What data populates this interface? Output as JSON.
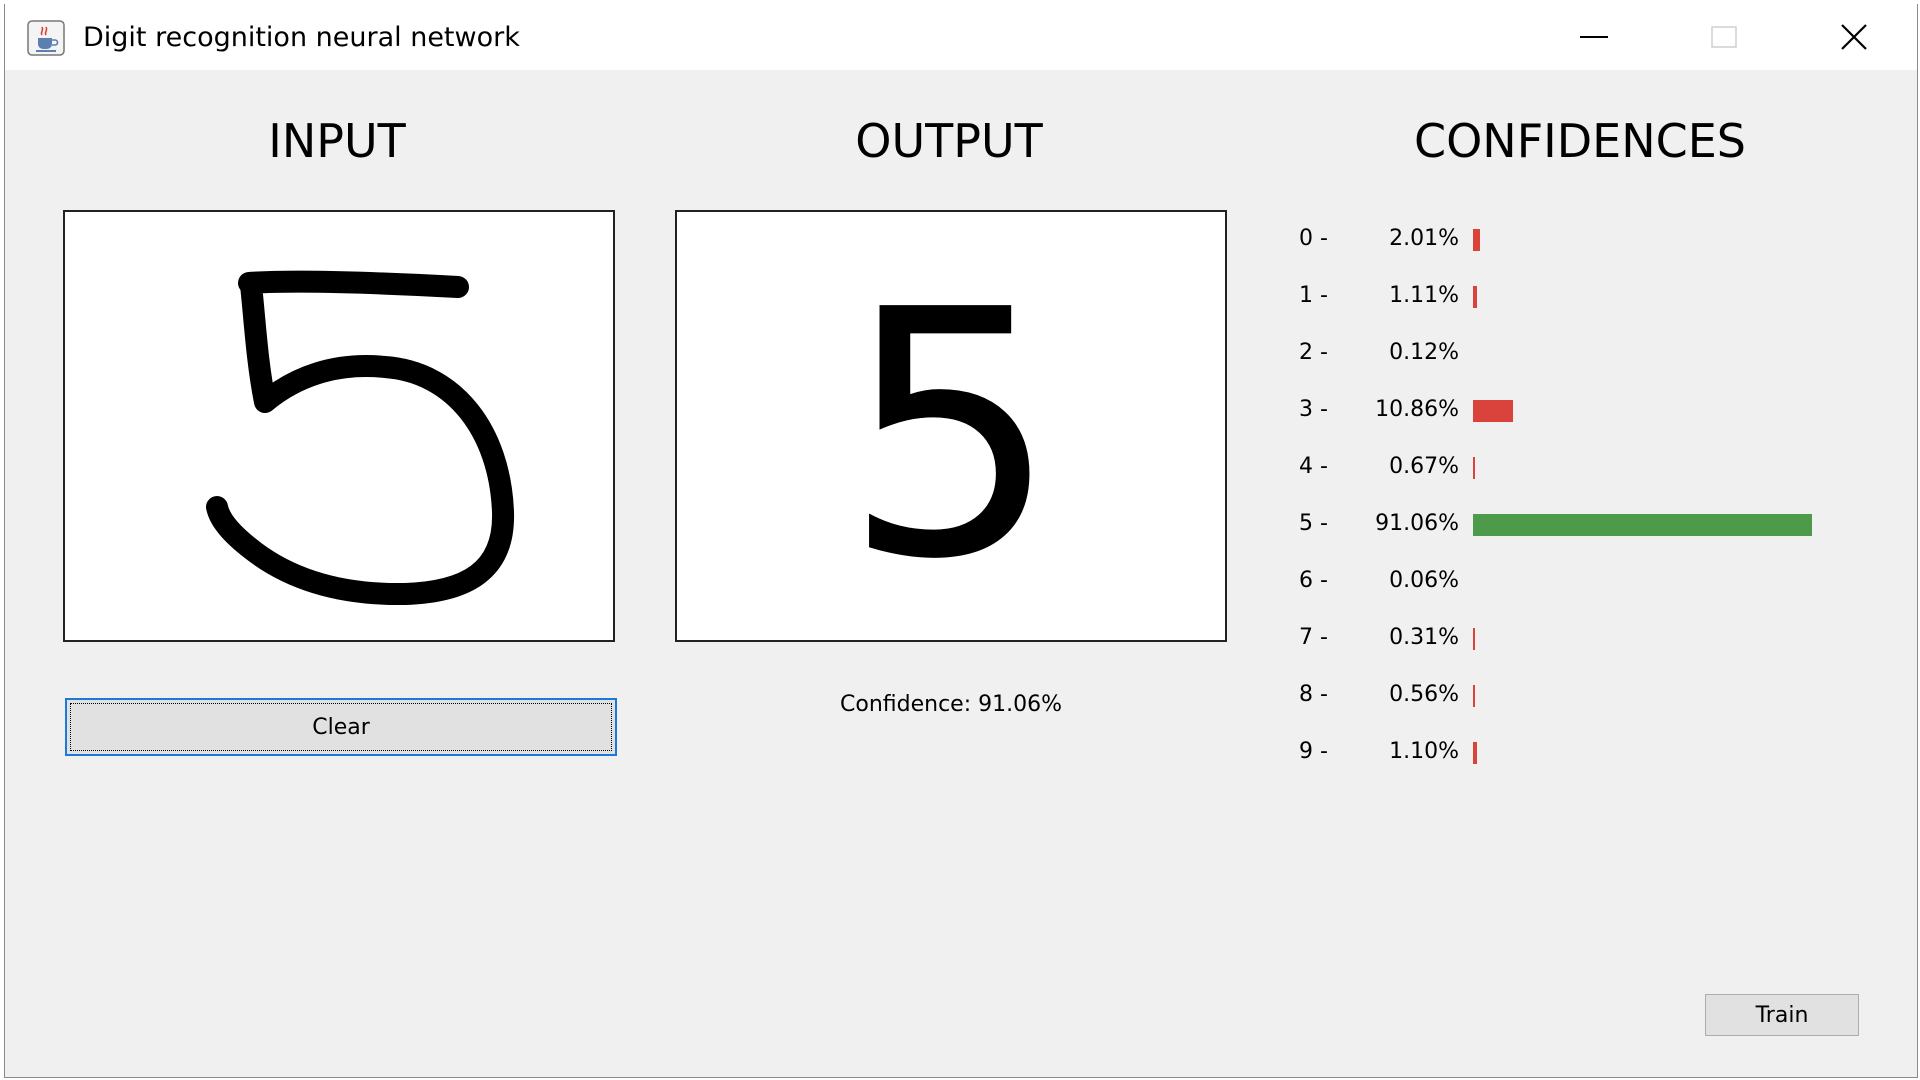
{
  "window": {
    "title": "Digit recognition neural network",
    "app_icon": "java-cup-icon"
  },
  "sections": {
    "input_title": "INPUT",
    "output_title": "OUTPUT",
    "confidences_title": "CONFIDENCES"
  },
  "input": {
    "drawn_digit": "5",
    "clear_label": "Clear"
  },
  "output": {
    "predicted_digit": "5",
    "confidence_text": "Confidence: 91.06%"
  },
  "confidences": [
    {
      "digit": "0 -",
      "percent": "2.01%",
      "value": 2.01
    },
    {
      "digit": "1 -",
      "percent": "1.11%",
      "value": 1.11
    },
    {
      "digit": "2 -",
      "percent": "0.12%",
      "value": 0.12
    },
    {
      "digit": "3 -",
      "percent": "10.86%",
      "value": 10.86
    },
    {
      "digit": "4 -",
      "percent": "0.67%",
      "value": 0.67
    },
    {
      "digit": "5 -",
      "percent": "91.06%",
      "value": 91.06
    },
    {
      "digit": "6 -",
      "percent": "0.06%",
      "value": 0.06
    },
    {
      "digit": "7 -",
      "percent": "0.31%",
      "value": 0.31
    },
    {
      "digit": "8 -",
      "percent": "0.56%",
      "value": 0.56
    },
    {
      "digit": "9 -",
      "percent": "1.10%",
      "value": 1.1
    }
  ],
  "colors": {
    "top_bar": "#4d9a4a",
    "other_bar": "#d9433b",
    "focus_border": "#1e78d7"
  },
  "train_label": "Train"
}
